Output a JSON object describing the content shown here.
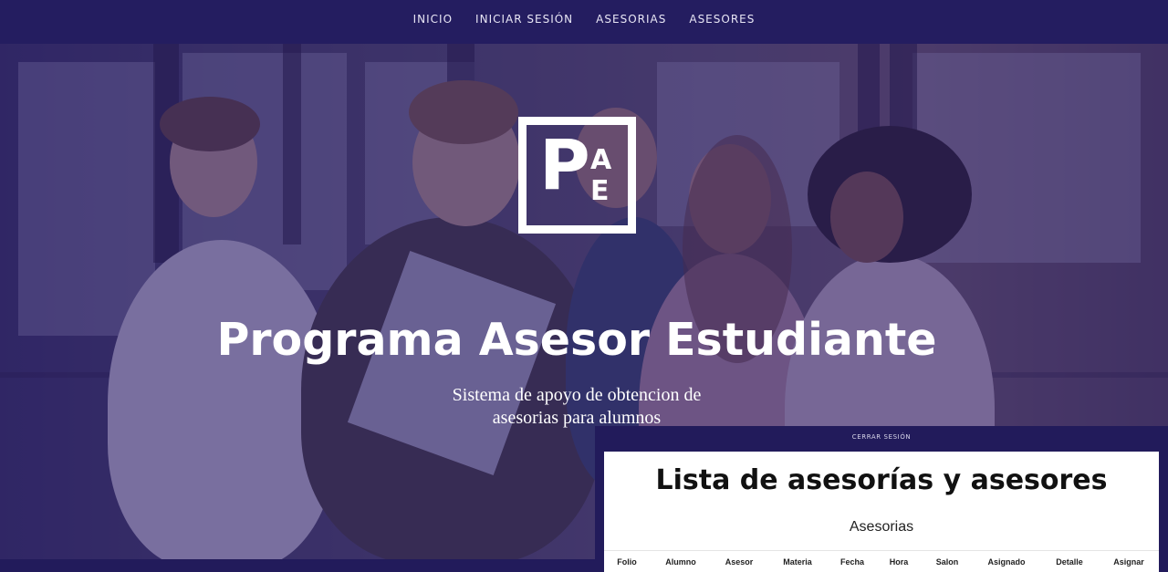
{
  "nav": {
    "items": [
      {
        "label": "INICIO"
      },
      {
        "label": "INICIAR SESIÓN"
      },
      {
        "label": "ASESORIAS"
      },
      {
        "label": "ASESORES"
      }
    ]
  },
  "hero": {
    "logo": {
      "big": "P",
      "top": "A",
      "bottom": "E"
    },
    "title": "Programa Asesor Estudiante",
    "subtitle_line1": "Sistema de apoyo de obtencion de",
    "subtitle_line2": "asesorias para alumnos"
  },
  "panel": {
    "logout_label": "CERRAR SESIÓN",
    "heading": "Lista de asesorías y asesores",
    "section_title": "Asesorias",
    "columns": [
      "Folio",
      "Alumno",
      "Asesor",
      "Materia",
      "Fecha",
      "Hora",
      "Salon",
      "Asignado",
      "Detalle",
      "Asignar"
    ]
  },
  "colors": {
    "nav_bg": "#241d60",
    "overlay": "#281c6e",
    "panel_bg": "#221b5b"
  }
}
